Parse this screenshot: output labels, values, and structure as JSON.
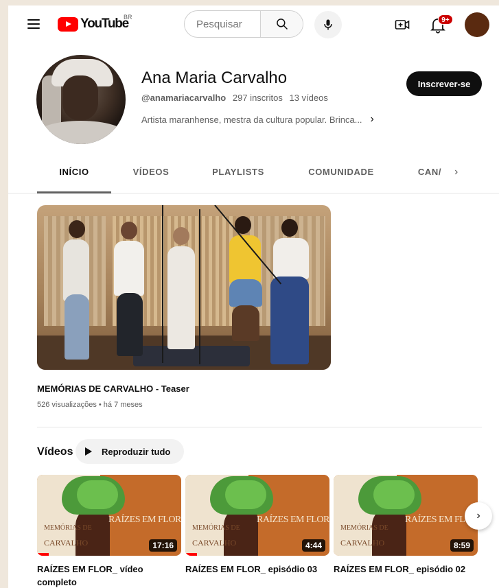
{
  "masthead": {
    "logo_text": "YouTube",
    "country_code": "BR",
    "search_placeholder": "Pesquisar",
    "notification_count": "9+",
    "icons": [
      "menu-icon",
      "search-icon",
      "mic-icon",
      "create-icon",
      "bell-icon"
    ]
  },
  "channel": {
    "name": "Ana Maria Carvalho",
    "handle": "@anamariacarvalho",
    "subscribers": "297 inscritos",
    "video_count": "13 vídeos",
    "description": "Artista maranhense, mestra da cultura popular. Brinca...",
    "subscribe_label": "Inscrever-se"
  },
  "tabs": [
    {
      "label": "INÍCIO",
      "active": true
    },
    {
      "label": "VÍDEOS",
      "active": false
    },
    {
      "label": "PLAYLISTS",
      "active": false
    },
    {
      "label": "COMUNIDADE",
      "active": false
    },
    {
      "label": "CAN/",
      "active": false
    }
  ],
  "featured": {
    "title": "MEMÓRIAS DE CARVALHO - Teaser",
    "meta": "526 visualizações • há 7 meses"
  },
  "videos_shelf": {
    "title": "Vídeos",
    "play_all_label": "Reproduzir tudo",
    "items": [
      {
        "title": "RAÍZES EM FLOR_ vídeo completo",
        "duration": "17:16",
        "thumb_heading": "RAÍZES EM FLOR",
        "thumb_sub": "MEMÓRIAS DE",
        "thumb_sub2": "CARVALHO",
        "progress": 0.08
      },
      {
        "title": "RAÍZES EM FLOR_ episódio 03",
        "duration": "4:44",
        "thumb_heading": "RAÍZES EM FLOR",
        "thumb_sub": "MEMÓRIAS DE",
        "thumb_sub2": "CARVALHO",
        "progress": 0.08
      },
      {
        "title": "RAÍZES EM FLOR_ episódio 02",
        "duration": "8:59",
        "thumb_heading": "RAÍZES EM FLOR",
        "thumb_sub": "MEMÓRIAS DE",
        "thumb_sub2": "CARVALHO",
        "progress": 0.0
      }
    ]
  },
  "colors": {
    "brand_red": "#ff0000",
    "subscribe_bg": "#0f0f0f",
    "avatar": "#5a2a10"
  }
}
